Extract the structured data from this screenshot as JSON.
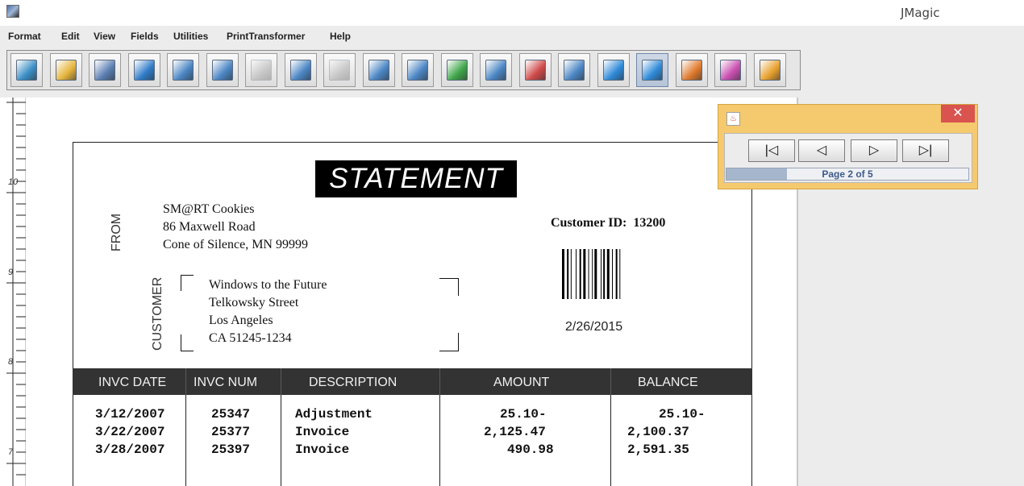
{
  "window": {
    "title": "JMagic"
  },
  "menu": [
    "Format",
    "Edit",
    "View",
    "Fields",
    "Utilities",
    "PrintTransformer",
    "Help"
  ],
  "toolbar": {
    "buttons": [
      {
        "name": "new-format-icon",
        "color": "#3a8fc6",
        "disabled": false,
        "selected": false
      },
      {
        "name": "open-folder-icon",
        "color": "#e6b53d",
        "disabled": false,
        "selected": false
      },
      {
        "name": "save-icon",
        "color": "#5b7fb3",
        "disabled": false,
        "selected": false
      },
      {
        "name": "import-icon",
        "color": "#2f7cc9",
        "disabled": false,
        "selected": false
      },
      {
        "name": "database-icon",
        "color": "#4b86c4",
        "disabled": false,
        "selected": false
      },
      {
        "name": "barcode-icon",
        "color": "#4b86c4",
        "disabled": false,
        "selected": false
      },
      {
        "name": "copy-field-icon",
        "color": "#8a8a8a",
        "disabled": true,
        "selected": false
      },
      {
        "name": "text-field-icon",
        "color": "#4b86c4",
        "disabled": false,
        "selected": false
      },
      {
        "name": "image-field-icon",
        "color": "#8a8a8a",
        "disabled": true,
        "selected": false
      },
      {
        "name": "box-field-icon",
        "color": "#4b86c4",
        "disabled": false,
        "selected": false
      },
      {
        "name": "line-field-icon",
        "color": "#4b86c4",
        "disabled": false,
        "selected": false
      },
      {
        "name": "new-field-icon",
        "color": "#3fa64a",
        "disabled": false,
        "selected": false
      },
      {
        "name": "list-field-icon",
        "color": "#4b86c4",
        "disabled": false,
        "selected": false
      },
      {
        "name": "properties-icon",
        "color": "#d04a4a",
        "disabled": false,
        "selected": false
      },
      {
        "name": "document-icon",
        "color": "#4b86c4",
        "disabled": false,
        "selected": false
      },
      {
        "name": "grid-icon",
        "color": "#2f8ad8",
        "disabled": false,
        "selected": false
      },
      {
        "name": "preview-icon",
        "color": "#2f8ad8",
        "disabled": false,
        "selected": true
      },
      {
        "name": "select-arrow-icon",
        "color": "#e07b2e",
        "disabled": false,
        "selected": false
      },
      {
        "name": "back-icon",
        "color": "#c94fb0",
        "disabled": false,
        "selected": false
      },
      {
        "name": "forward-icon",
        "color": "#e8a12e",
        "disabled": false,
        "selected": false
      }
    ]
  },
  "ruler": {
    "numbers": [
      "10",
      "9",
      "8",
      "7"
    ]
  },
  "statement": {
    "title": "STATEMENT",
    "from_label": "FROM",
    "from_lines": [
      "SM@RT Cookies",
      "86 Maxwell Road",
      "Cone of Silence, MN  99999"
    ],
    "customer_label": "CUSTOMER",
    "customer_lines": [
      "Windows to the Future",
      "Telkowsky Street",
      "Los Angeles",
      "CA  51245-1234"
    ],
    "customer_id_label": "Customer ID:",
    "customer_id": "13200",
    "date": "2/26/2015",
    "table": {
      "headers": [
        "INVC DATE",
        "INVC NUM",
        "DESCRIPTION",
        "AMOUNT",
        "BALANCE"
      ],
      "rows": [
        [
          "3/12/2007",
          "25347",
          "Adjustment",
          "25.10-",
          "25.10-"
        ],
        [
          "3/22/2007",
          "25377",
          "Invoice",
          "2,125.47",
          "2,100.37"
        ],
        [
          "3/28/2007",
          "25397",
          "Invoice",
          "490.98",
          "2,591.35"
        ]
      ]
    }
  },
  "navigator": {
    "buttons": [
      "|◁",
      "◁",
      "▷",
      "▷|"
    ],
    "page_text": "Page 2 of 5",
    "progress": 0.25,
    "close": "✕"
  }
}
